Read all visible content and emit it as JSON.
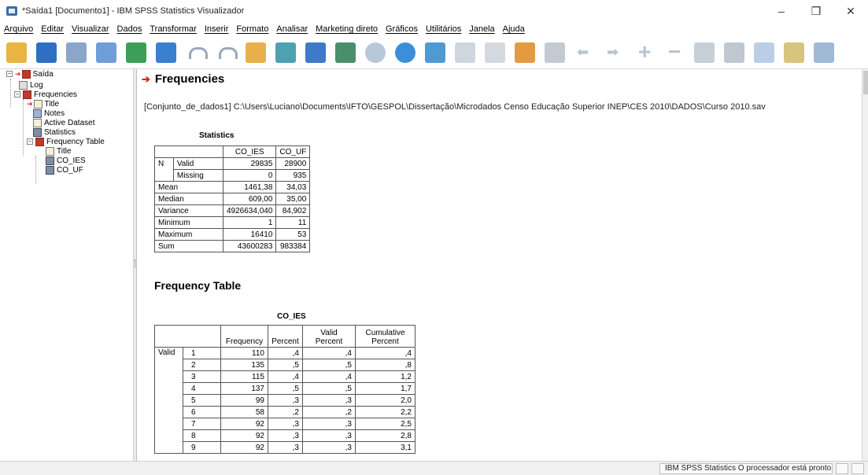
{
  "window": {
    "title": "*Saída1 [Documento1] - IBM SPSS Statistics Visualizador",
    "minimize": "–",
    "maximize": "❐",
    "close": "✕"
  },
  "menu": [
    "Arquivo",
    "Editar",
    "Visualizar",
    "Dados",
    "Transformar",
    "Inserir",
    "Formato",
    "Analisar",
    "Marketing direto",
    "Gráficos",
    "Utilitários",
    "Janela",
    "Ajuda"
  ],
  "toolbar": [
    "open-icon",
    "save-icon",
    "print-icon",
    "print-preview-icon",
    "export-icon",
    "recall-dialog-icon",
    "undo-icon",
    "redo-icon",
    "goto-data-icon",
    "goto-case-icon",
    "goto-variable-icon",
    "variables-icon",
    "circle-icon",
    "run-icon",
    "split-file-icon",
    "designate-window-icon",
    "show-output-icon",
    "hide-output-icon",
    "select-last-output-icon",
    "promote-icon",
    "demote-icon",
    "expand-icon",
    "collapse-icon",
    "show-icon",
    "hide-icon",
    "insert-heading-icon",
    "insert-title-icon",
    "insert-text-icon"
  ],
  "outline": {
    "root": "Saída",
    "log": "Log",
    "frequencies": "Frequencies",
    "title": "Title",
    "notes": "Notes",
    "active_dataset": "Active Dataset",
    "statistics": "Statistics",
    "freq_table": "Frequency Table",
    "ft_title": "Title",
    "co_ies": "CO_IES",
    "co_uf": "CO_UF"
  },
  "content": {
    "heading": "Frequencies",
    "dataset_path": "[Conjunto_de_dados1] C:\\Users\\Luciano\\Documents\\IFTO\\GESPOL\\Dissertação\\Microdados Censo Educação Superior INEP\\CES 2010\\DADOS\\Curso 2010.sav",
    "stats": {
      "title": "Statistics",
      "columns": [
        "CO_IES",
        "CO_UF"
      ],
      "rows": [
        {
          "label": "N",
          "sub": "Valid",
          "v1": "29835",
          "v2": "28900"
        },
        {
          "label": "",
          "sub": "Missing",
          "v1": "0",
          "v2": "935"
        },
        {
          "label": "Mean",
          "sub": "",
          "v1": "1461,38",
          "v2": "34,03"
        },
        {
          "label": "Median",
          "sub": "",
          "v1": "609,00",
          "v2": "35,00"
        },
        {
          "label": "Variance",
          "sub": "",
          "v1": "4926634,040",
          "v2": "84,902"
        },
        {
          "label": "Minimum",
          "sub": "",
          "v1": "1",
          "v2": "11"
        },
        {
          "label": "Maximum",
          "sub": "",
          "v1": "16410",
          "v2": "53"
        },
        {
          "label": "Sum",
          "sub": "",
          "v1": "43600283",
          "v2": "983384"
        }
      ]
    },
    "freq_heading": "Frequency Table",
    "freq": {
      "title": "CO_IES",
      "columns": [
        "Frequency",
        "Percent",
        "Valid Percent",
        "Cumulative Percent"
      ],
      "valid_label": "Valid",
      "rows": [
        {
          "v": "1",
          "f": "110",
          "p": ",4",
          "vp": ",4",
          "cp": ",4"
        },
        {
          "v": "2",
          "f": "135",
          "p": ",5",
          "vp": ",5",
          "cp": ",8"
        },
        {
          "v": "3",
          "f": "115",
          "p": ",4",
          "vp": ",4",
          "cp": "1,2"
        },
        {
          "v": "4",
          "f": "137",
          "p": ",5",
          "vp": ",5",
          "cp": "1,7"
        },
        {
          "v": "5",
          "f": "99",
          "p": ",3",
          "vp": ",3",
          "cp": "2,0"
        },
        {
          "v": "6",
          "f": "58",
          "p": ",2",
          "vp": ",2",
          "cp": "2,2"
        },
        {
          "v": "7",
          "f": "92",
          "p": ",3",
          "vp": ",3",
          "cp": "2,5"
        },
        {
          "v": "8",
          "f": "92",
          "p": ",3",
          "vp": ",3",
          "cp": "2,8"
        },
        {
          "v": "9",
          "f": "92",
          "p": ",3",
          "vp": ",3",
          "cp": "3,1"
        }
      ]
    }
  },
  "status": {
    "message": "IBM SPSS Statistics O processador está pronto"
  }
}
